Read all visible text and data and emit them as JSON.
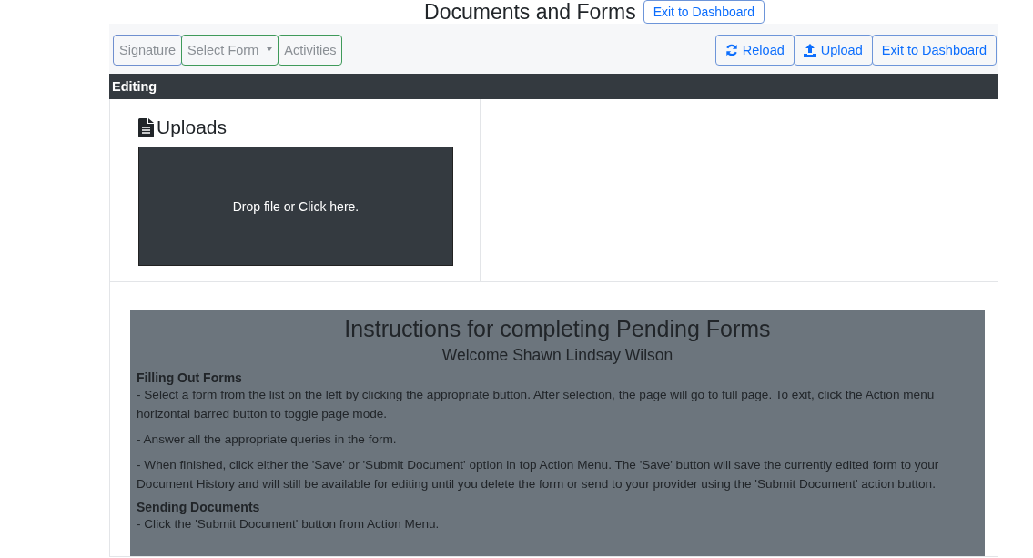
{
  "header": {
    "title": "Documents and Forms",
    "exit_button": "Exit to Dashboard"
  },
  "toolbar": {
    "left_buttons": [
      {
        "label": "Signature",
        "kind": "plain",
        "color": "#6f8fcf"
      },
      {
        "label": "Select Form",
        "kind": "dropdown",
        "color": "#3f9a5a"
      },
      {
        "label": "Activities",
        "kind": "plain",
        "color": "#3f9a5a"
      }
    ],
    "right_buttons": [
      {
        "label": "Reload",
        "kind": "reload"
      },
      {
        "label": "Upload",
        "kind": "upload"
      },
      {
        "label": "Exit to Dashboard",
        "kind": "plain"
      }
    ]
  },
  "editing_bar": "Editing",
  "uploads": {
    "title": "Uploads",
    "dropzone": "Drop file or Click here."
  },
  "instructions": {
    "title": "Instructions for completing Pending Forms",
    "welcome": "Welcome Shawn Lindsay Wilson",
    "sections": [
      {
        "heading": "Filling Out Forms",
        "paragraphs": [
          "- Select a form from the list on the left by clicking the appropriate button. After selection, the page will go to full page. To exit, click the Action menu horizontal barred button to toggle page mode.",
          "- Answer all the appropriate queries in the form.",
          "- When finished, click either the 'Save' or 'Submit Document' option in top Action Menu. The 'Save' button will save the currently edited form to your Document History and will still be available for editing until you delete the form or send to your provider using the 'Submit Document' action button."
        ]
      },
      {
        "heading": "Sending Documents",
        "paragraphs": [
          "- Click the 'Submit Document' button from Action Menu."
        ]
      }
    ]
  }
}
